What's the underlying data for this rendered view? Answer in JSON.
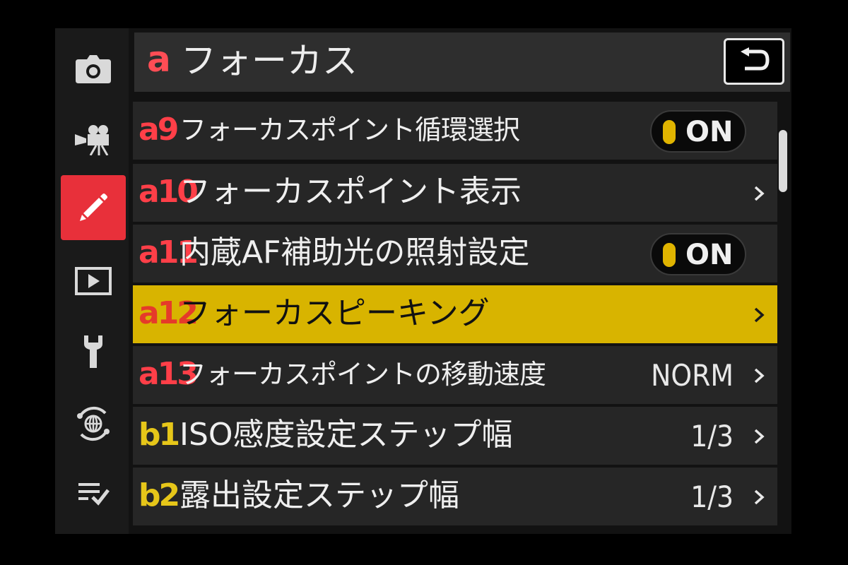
{
  "header": {
    "letter": "a",
    "title": "フォーカス"
  },
  "sidebar": {
    "items": [
      {
        "icon": "camera-icon",
        "active": false
      },
      {
        "icon": "movie-camera-icon",
        "active": false
      },
      {
        "icon": "pencil-icon",
        "active": true
      },
      {
        "icon": "playback-icon",
        "active": false
      },
      {
        "icon": "wrench-icon",
        "active": false
      },
      {
        "icon": "network-icon",
        "active": false
      },
      {
        "icon": "my-menu-icon",
        "active": false
      }
    ]
  },
  "menu": {
    "rows": [
      {
        "code": "a9",
        "marked": true,
        "label": "フォーカスポイント循環選択",
        "value": "ON",
        "control": "toggle"
      },
      {
        "code": "a10",
        "marked": false,
        "label": "フォーカスポイント表示",
        "value": "",
        "control": "chevron"
      },
      {
        "code": "a11",
        "marked": false,
        "label": "内蔵AF補助光の照射設定",
        "value": "ON",
        "control": "toggle"
      },
      {
        "code": "a12",
        "marked": true,
        "label": "フォーカスピーキング",
        "value": "",
        "control": "chevron",
        "selected": true
      },
      {
        "code": "a13",
        "marked": false,
        "label": "フォーカスポイントの移動速度",
        "value": "NORM",
        "control": "chevron"
      },
      {
        "code": "b1",
        "marked": false,
        "label": "ISO感度設定ステップ幅",
        "value": "1/3",
        "control": "chevron"
      },
      {
        "code": "b2",
        "marked": false,
        "label": "露出設定ステップ幅",
        "value": "1/3",
        "control": "chevron"
      }
    ]
  },
  "colors": {
    "accent_red": "#e8303a",
    "selected_yellow": "#d8b400",
    "toggle_knob": "#e0b400",
    "b_code_yellow": "#e6c619"
  }
}
